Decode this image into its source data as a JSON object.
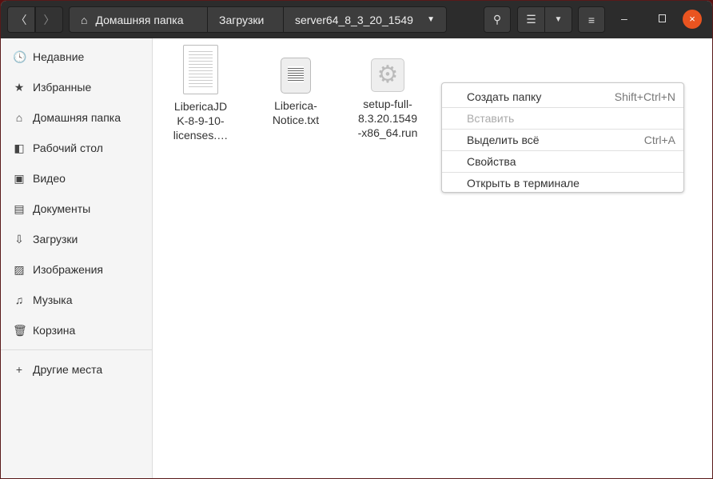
{
  "header": {
    "breadcrumbs": [
      "Домашняя папка",
      "Загрузки",
      "server64_8_3_20_1549"
    ]
  },
  "sidebar": {
    "items": [
      {
        "icon": "clock-icon",
        "glyph": "🕓",
        "label": "Недавние"
      },
      {
        "icon": "star-icon",
        "glyph": "★",
        "label": "Избранные"
      },
      {
        "icon": "home-icon",
        "glyph": "⌂",
        "label": "Домашняя папка"
      },
      {
        "icon": "desktop-icon",
        "glyph": "◧",
        "label": "Рабочий стол"
      },
      {
        "icon": "video-icon",
        "glyph": "▣",
        "label": "Видео"
      },
      {
        "icon": "document-icon",
        "glyph": "▤",
        "label": "Документы"
      },
      {
        "icon": "download-icon",
        "glyph": "⇩",
        "label": "Загрузки"
      },
      {
        "icon": "image-icon",
        "glyph": "▨",
        "label": "Изображения"
      },
      {
        "icon": "music-icon",
        "glyph": "♫",
        "label": "Музыка"
      },
      {
        "icon": "trash-icon",
        "glyph": "🗑",
        "label": "Корзина"
      }
    ],
    "other": {
      "glyph": "+",
      "label": "Другие места"
    }
  },
  "files": [
    {
      "name": "LibericaJD K-8-9-10- licenses.…",
      "type": "document"
    },
    {
      "name": "Liberica- Notice.txt",
      "type": "text"
    },
    {
      "name": "setup-full- 8.3.20.1549 -x86_64.run",
      "type": "executable"
    }
  ],
  "context_menu": [
    {
      "label": "Создать папку",
      "shortcut": "Shift+Ctrl+N"
    },
    {
      "label": "Вставить",
      "shortcut": ""
    },
    {
      "label": "Выделить всё",
      "shortcut": "Ctrl+A"
    },
    {
      "label": "Свойства",
      "shortcut": ""
    },
    {
      "label": "Открыть в терминале",
      "shortcut": ""
    }
  ]
}
